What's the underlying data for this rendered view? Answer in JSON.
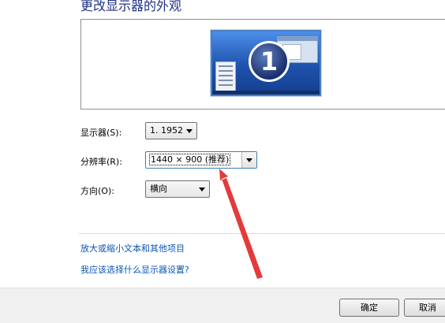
{
  "page": {
    "title": "更改显示器的外观"
  },
  "preview": {
    "monitor_number": "1"
  },
  "display": {
    "label": "显示器(S):",
    "value": "1. 1952"
  },
  "resolution": {
    "label": "分辨率(R):",
    "value": "1440 × 900 (推荐)"
  },
  "orientation": {
    "label": "方向(O):",
    "value": "横向"
  },
  "links": {
    "enlarge_text": "放大或缩小文本和其他项目",
    "which_settings": "我应该选择什么显示器设置?"
  },
  "buttons": {
    "ok": "确定",
    "cancel": "取消"
  },
  "annotation": {
    "arrow_color": "#e53a3a"
  },
  "icons": [
    "monitor-icon",
    "dropdown-arrow-icon"
  ]
}
